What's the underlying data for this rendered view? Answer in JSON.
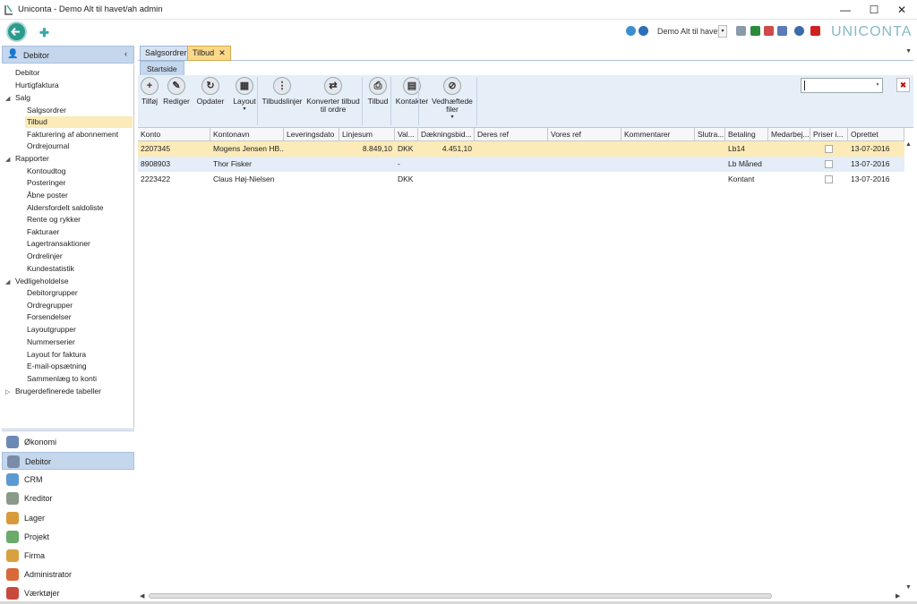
{
  "window": {
    "title": "Uniconta - Demo Alt til havet/ah admin",
    "minimize": "—",
    "maximize": "☐",
    "close": "✕"
  },
  "header": {
    "company": "Demo Alt til havet",
    "logo": "UNICONTA"
  },
  "left_panel": {
    "title": "Debitor",
    "collapse": "‹",
    "tree": [
      {
        "label": "Debitor",
        "level": 1
      },
      {
        "label": "Hurtigfaktura",
        "level": 1
      },
      {
        "label": "Salg",
        "level": 0,
        "expander": "◢"
      },
      {
        "label": "Salgsordrer",
        "level": 2
      },
      {
        "label": "Tilbud",
        "level": 2,
        "selected": true
      },
      {
        "label": "Fakturering af abonnement",
        "level": 2
      },
      {
        "label": "Ordrejournal",
        "level": 2
      },
      {
        "label": "Rapporter",
        "level": 0,
        "expander": "◢"
      },
      {
        "label": "Kontoudtog",
        "level": 2
      },
      {
        "label": "Posteringer",
        "level": 2
      },
      {
        "label": "Åbne poster",
        "level": 2
      },
      {
        "label": "Aldersfordelt saldoliste",
        "level": 2
      },
      {
        "label": "Rente og rykker",
        "level": 2
      },
      {
        "label": "Fakturaer",
        "level": 2
      },
      {
        "label": "Lagertransaktioner",
        "level": 2
      },
      {
        "label": "Ordrelinjer",
        "level": 2
      },
      {
        "label": "Kundestatistik",
        "level": 2
      },
      {
        "label": "Vedligeholdelse",
        "level": 0,
        "expander": "◢"
      },
      {
        "label": "Debitorgrupper",
        "level": 2
      },
      {
        "label": "Ordregrupper",
        "level": 2
      },
      {
        "label": "Forsendelser",
        "level": 2
      },
      {
        "label": "Layoutgrupper",
        "level": 2
      },
      {
        "label": "Nummerserier",
        "level": 2
      },
      {
        "label": "Layout for faktura",
        "level": 2
      },
      {
        "label": "E-mail-opsætning",
        "level": 2
      },
      {
        "label": "Sammenlæg to konti",
        "level": 2
      },
      {
        "label": "Brugerdefinerede tabeller",
        "level": 0,
        "expander": "▷"
      }
    ],
    "nav": [
      {
        "label": "Økonomi",
        "icon": "economy-icon",
        "color": "#6a89b5"
      },
      {
        "label": "Debitor",
        "icon": "debtor-icon",
        "color": "#7a8da8",
        "active": true
      },
      {
        "label": "CRM",
        "icon": "crm-icon",
        "color": "#5a9ad0"
      },
      {
        "label": "Kreditor",
        "icon": "creditor-icon",
        "color": "#8a9a8a"
      },
      {
        "label": "Lager",
        "icon": "inventory-icon",
        "color": "#d89a3a"
      },
      {
        "label": "Projekt",
        "icon": "project-icon",
        "color": "#6aaa6a"
      },
      {
        "label": "Firma",
        "icon": "company-icon",
        "color": "#d8a040"
      },
      {
        "label": "Administrator",
        "icon": "admin-icon",
        "color": "#d86a3a"
      },
      {
        "label": "Værktøjer",
        "icon": "tools-icon",
        "color": "#c84a3a"
      }
    ]
  },
  "tabs": [
    {
      "label": "Salgsordrer"
    },
    {
      "label": "Tilbud",
      "close": "✕"
    }
  ],
  "subtab": "Startside",
  "ribbon": {
    "buttons": [
      {
        "label": "Tilføj",
        "glyph": "+",
        "icon": "add-icon"
      },
      {
        "label": "Rediger",
        "glyph": "✎",
        "icon": "edit-icon"
      },
      {
        "label": "Opdater",
        "glyph": "↻",
        "icon": "refresh-icon"
      },
      {
        "label": "Layout",
        "glyph": "▦",
        "icon": "layout-icon",
        "dropdown": "▾"
      },
      {
        "label": "Tilbudslinjer",
        "glyph": "⋮",
        "icon": "offer-lines-icon"
      },
      {
        "label": "Konverter tilbud\ntil ordre",
        "glyph": "⇄",
        "icon": "convert-icon"
      },
      {
        "label": "Tilbud",
        "glyph": "⎙",
        "icon": "print-icon"
      },
      {
        "label": "Kontakter",
        "glyph": "▤",
        "icon": "contacts-icon"
      },
      {
        "label": "Vedhæftede\nfiler",
        "glyph": "⊘",
        "icon": "attachment-icon",
        "dropdown": "▾"
      }
    ]
  },
  "search": {
    "value": "",
    "clear": "✖"
  },
  "grid": {
    "columns": [
      "Konto",
      "Kontonavn",
      "Leveringsdato",
      "Linjesum",
      "Val...",
      "Dækningsbid...",
      "Deres ref",
      "Vores ref",
      "Kommentarer",
      "Slutra...",
      "Betaling",
      "Medarbej...",
      "Priser i...",
      "Oprettet"
    ],
    "rows": [
      [
        "2207345",
        "Mogens Jensen HB...",
        "",
        "8.849,10",
        "DKK",
        "4.451,10",
        "",
        "",
        "",
        "",
        "Lb14",
        "",
        "",
        "13-07-2016"
      ],
      [
        "8908903",
        "Thor Fisker",
        "",
        "",
        "-",
        "",
        "",
        "",
        "",
        "",
        "Lb Måned",
        "",
        "",
        "13-07-2016"
      ],
      [
        "2223422",
        "Claus Høj-Nielsen",
        "",
        "",
        "DKK",
        "",
        "",
        "",
        "",
        "",
        "Kontant",
        "",
        "",
        "13-07-2016"
      ]
    ]
  }
}
